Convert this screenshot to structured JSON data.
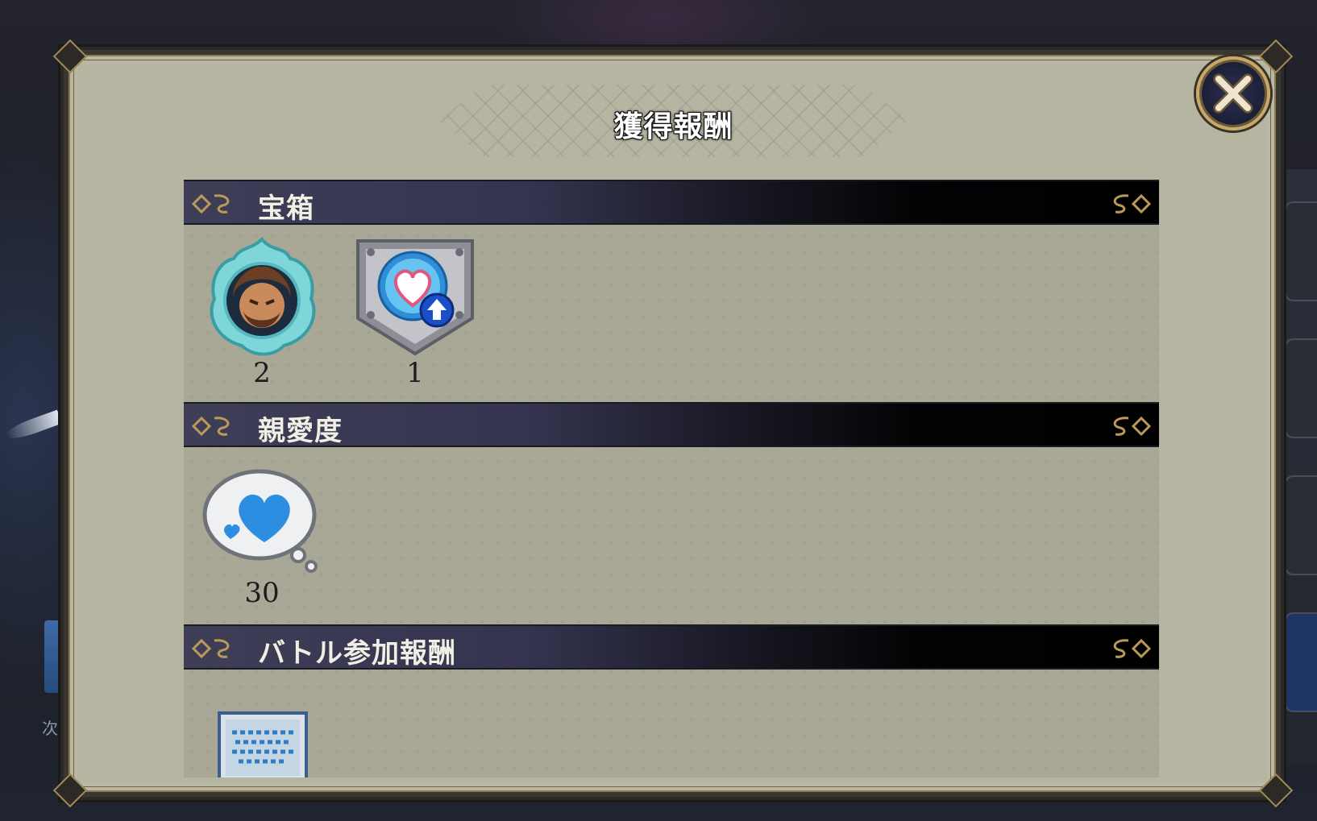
{
  "dialog": {
    "title": "獲得報酬",
    "close_icon": "close-x-icon"
  },
  "sections": [
    {
      "label": "宝箱",
      "items": [
        {
          "icon": "character-fragment-icon",
          "count": "2"
        },
        {
          "icon": "affection-up-badge-icon",
          "count": "1"
        }
      ]
    },
    {
      "label": "親愛度",
      "items": [
        {
          "icon": "heart-bubble-icon",
          "count": "30"
        }
      ]
    },
    {
      "label": "バトル参加報酬",
      "items": [
        {
          "icon": "ticket-scroll-icon",
          "count": ""
        }
      ]
    }
  ],
  "background": {
    "left_text": "次"
  },
  "colors": {
    "panel_bg": "#a9a897",
    "header_dark": "#000000",
    "gold_accent": "#c9a96a"
  }
}
